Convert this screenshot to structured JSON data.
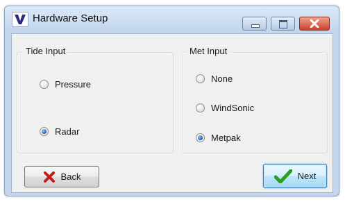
{
  "window": {
    "title": "Hardware Setup",
    "controls": [
      "minimize-icon",
      "maximize-icon",
      "close-icon"
    ]
  },
  "tide_input": {
    "label": "Tide Input",
    "options": [
      {
        "label": "Pressure",
        "selected": false
      },
      {
        "label": "Radar",
        "selected": true
      }
    ]
  },
  "met_input": {
    "label": "Met Input",
    "options": [
      {
        "label": "None",
        "selected": false
      },
      {
        "label": "WindSonic",
        "selected": false
      },
      {
        "label": "Metpak",
        "selected": true
      }
    ]
  },
  "buttons": {
    "back_label": "Back",
    "back_icon": "red-x-icon",
    "next_label": "Next",
    "next_icon": "green-check-icon"
  },
  "colors": {
    "accent": "#2f6fc6",
    "back_icon": "#c61a1a",
    "next_icon": "#2f9e1d"
  }
}
